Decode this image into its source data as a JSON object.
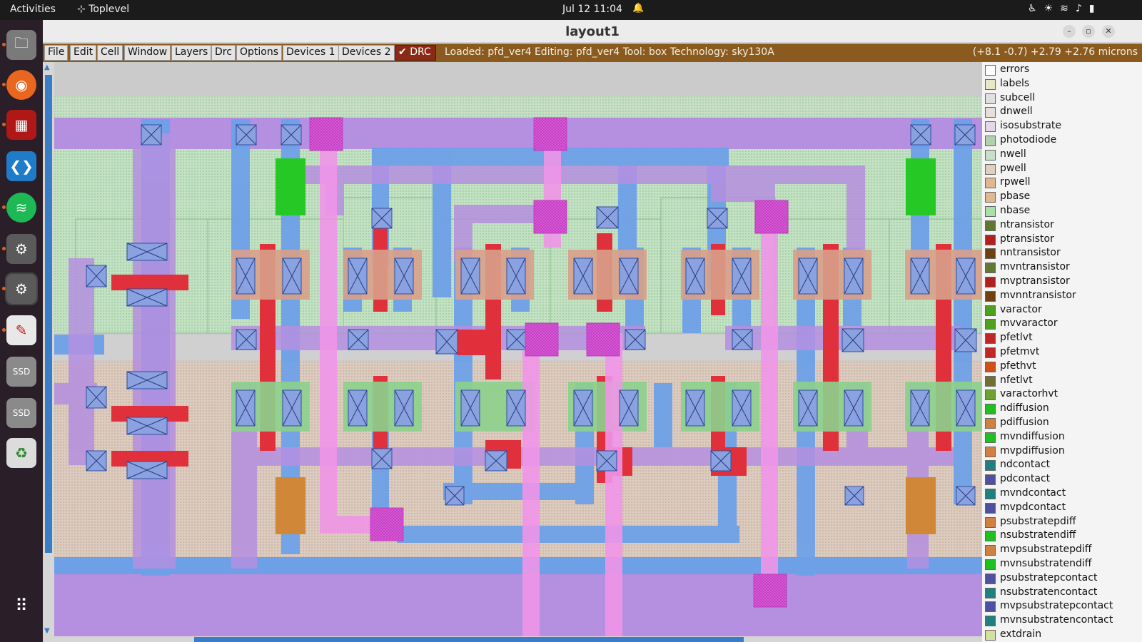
{
  "topbar": {
    "activities": "Activities",
    "app_name": "Toplevel",
    "clock": "Jul 12  11:04"
  },
  "window": {
    "title": "layout1"
  },
  "menu": {
    "items": [
      "File",
      "Edit",
      "Cell",
      "Window",
      "Layers",
      "Drc",
      "Options",
      "Devices 1",
      "Devices 2"
    ],
    "drc_label": "DRC",
    "status": "Loaded: pfd_ver4 Editing: pfd_ver4 Tool: box  Technology: sky130A",
    "coords": "(+8.1 -0.7) +2.79 +2.76 microns"
  },
  "legend": {
    "layers": [
      {
        "name": "errors",
        "color": "#ffffff"
      },
      {
        "name": "labels",
        "color": "#e8e8c8"
      },
      {
        "name": "subcell",
        "color": "#e0e0e0"
      },
      {
        "name": "dnwell",
        "color": "#e6e0d8"
      },
      {
        "name": "isosubstrate",
        "color": "#e2d8e8"
      },
      {
        "name": "photodiode",
        "color": "#b0d0b0"
      },
      {
        "name": "nwell",
        "color": "#c8e0c8"
      },
      {
        "name": "pwell",
        "color": "#e0d0c0"
      },
      {
        "name": "rpwell",
        "color": "#e0b890"
      },
      {
        "name": "pbase",
        "color": "#e0b890"
      },
      {
        "name": "nbase",
        "color": "#a8e0a8"
      },
      {
        "name": "ntransistor",
        "color": "#607830"
      },
      {
        "name": "ptransistor",
        "color": "#b02020"
      },
      {
        "name": "nntransistor",
        "color": "#704010"
      },
      {
        "name": "mvntransistor",
        "color": "#607830"
      },
      {
        "name": "mvptransistor",
        "color": "#b02020"
      },
      {
        "name": "mvnntransistor",
        "color": "#704010"
      },
      {
        "name": "varactor",
        "color": "#50a020"
      },
      {
        "name": "mvvaractor",
        "color": "#50a020"
      },
      {
        "name": "pfetlvt",
        "color": "#c02828"
      },
      {
        "name": "pfetmvt",
        "color": "#c02828"
      },
      {
        "name": "pfethvt",
        "color": "#d05018"
      },
      {
        "name": "nfetlvt",
        "color": "#707030"
      },
      {
        "name": "varactorhvt",
        "color": "#70a030"
      },
      {
        "name": "ndiffusion",
        "color": "#20c020"
      },
      {
        "name": "pdiffusion",
        "color": "#d08040"
      },
      {
        "name": "mvndiffusion",
        "color": "#20c020"
      },
      {
        "name": "mvpdiffusion",
        "color": "#d08040"
      },
      {
        "name": "ndcontact",
        "color": "#208080"
      },
      {
        "name": "pdcontact",
        "color": "#5050a0"
      },
      {
        "name": "mvndcontact",
        "color": "#208080"
      },
      {
        "name": "mvpdcontact",
        "color": "#5050a0"
      },
      {
        "name": "psubstratepdiff",
        "color": "#d08040"
      },
      {
        "name": "nsubstratendiff",
        "color": "#20c020"
      },
      {
        "name": "mvpsubstratepdiff",
        "color": "#d08040"
      },
      {
        "name": "mvnsubstratendiff",
        "color": "#20c020"
      },
      {
        "name": "psubstratepcontact",
        "color": "#5050a0"
      },
      {
        "name": "nsubstratencontact",
        "color": "#208080"
      },
      {
        "name": "mvpsubstratepcontact",
        "color": "#5050a0"
      },
      {
        "name": "mvnsubstratencontact",
        "color": "#208080"
      },
      {
        "name": "extdrain",
        "color": "#d0e0a0"
      }
    ]
  },
  "colors": {
    "accent_menu": "#8a5a1e",
    "scroll": "#3b7cc6",
    "metal1": "#b07ee0",
    "li1": "#6a9ee8",
    "poly": "#e03040",
    "metal2": "#f090e0",
    "nwell": "#bfe3bf",
    "psub": "#dcc9bd"
  },
  "dock": {
    "apps": [
      "files-icon",
      "firefox-icon",
      "magic-icon",
      "vscode-icon",
      "spotify-icon",
      "settings-icon",
      "settings-icon",
      "text-editor-icon",
      "disk-icon",
      "disk-icon",
      "trash-icon",
      "app-grid-icon"
    ]
  }
}
